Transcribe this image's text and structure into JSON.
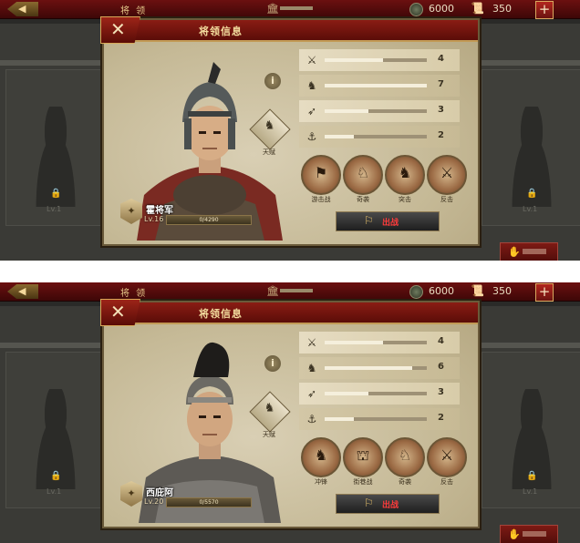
{
  "topbar": {
    "title": "将 领",
    "coins": "6000",
    "scrolls": "350",
    "plus": "+",
    "back": "◀"
  },
  "dialog": {
    "title": "将领信息",
    "talent_label": "天赋",
    "close": "✕"
  },
  "screens": [
    {
      "general": {
        "name": "霍将军",
        "level": "Lv.16",
        "exp": "0/4290",
        "exp_fraction": 0.0
      },
      "stats": [
        {
          "icon": "sword-icon",
          "value": "4",
          "fraction": 0.57
        },
        {
          "icon": "horse-icon",
          "value": "7",
          "fraction": 1.0
        },
        {
          "icon": "bow-icon",
          "value": "3",
          "fraction": 0.43
        },
        {
          "icon": "anchor-icon",
          "value": "2",
          "fraction": 0.29
        }
      ],
      "skills": [
        {
          "icon": "guerrilla-icon",
          "label": "游击战"
        },
        {
          "icon": "raid-icon",
          "label": "奇袭"
        },
        {
          "icon": "charge-icon",
          "label": "突击"
        },
        {
          "icon": "counter-icon",
          "label": "反击"
        }
      ],
      "action": {
        "label": "出战"
      }
    },
    {
      "general": {
        "name": "西庇阿",
        "level": "Lv.20",
        "exp": "0/5570",
        "exp_fraction": 0.0
      },
      "stats": [
        {
          "icon": "sword-icon",
          "value": "4",
          "fraction": 0.57
        },
        {
          "icon": "horse-icon",
          "value": "6",
          "fraction": 0.86
        },
        {
          "icon": "bow-icon",
          "value": "3",
          "fraction": 0.43
        },
        {
          "icon": "anchor-icon",
          "value": "2",
          "fraction": 0.29
        }
      ],
      "skills": [
        {
          "icon": "charge-icon",
          "label": "冲锋"
        },
        {
          "icon": "street-fight-icon",
          "label": "街巷战"
        },
        {
          "icon": "raid-icon",
          "label": "奇袭"
        },
        {
          "icon": "counter-icon",
          "label": "反击"
        }
      ],
      "action": {
        "label": "出战"
      }
    }
  ],
  "recruit": {
    "icon": "recruit-icon"
  }
}
